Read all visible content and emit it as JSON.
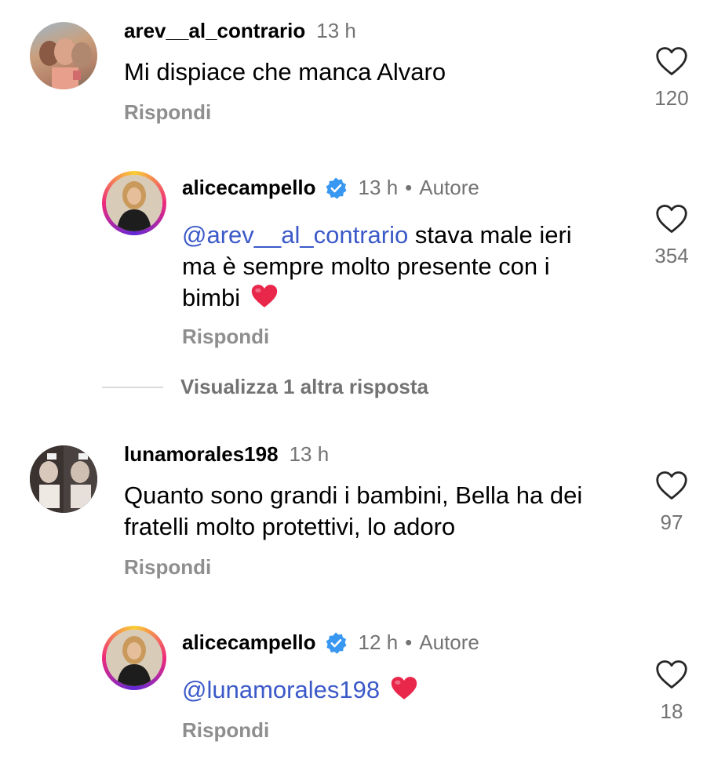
{
  "comments": [
    {
      "username": "arev__al_contrario",
      "time": "13 h",
      "text": "Mi dispiace che manca Alvaro",
      "reply_label": "Rispondi",
      "likes": "120"
    },
    {
      "username": "alicecampello",
      "time": "13 h",
      "author_tag": "Autore",
      "mention": "@arev__al_contrario",
      "text_line1": " stava male ieri",
      "text_line2": "ma è sempre molto presente con i",
      "text_line3": "bimbi",
      "reply_label": "Rispondi",
      "likes": "354"
    },
    {
      "username": "lunamorales198",
      "time": "13 h",
      "text_line1": "Quanto sono grandi i bambini, Bella ha dei",
      "text_line2": "fratelli molto protettivi, lo adoro",
      "reply_label": "Rispondi",
      "likes": "97"
    },
    {
      "username": "alicecampello",
      "time": "12 h",
      "author_tag": "Autore",
      "mention": "@lunamorales198",
      "reply_label": "Rispondi",
      "likes": "18"
    }
  ],
  "view_more_replies": "Visualizza 1 altra risposta",
  "icons": {
    "like": "heart-outline-icon",
    "verified": "verified-badge-icon",
    "emoji": "red-heart-emoji"
  },
  "colors": {
    "mention": "#3b59c8",
    "secondary_text": "#737373",
    "verified": "#3897f0",
    "heart_emoji": "#e8274b"
  },
  "separator": "•"
}
